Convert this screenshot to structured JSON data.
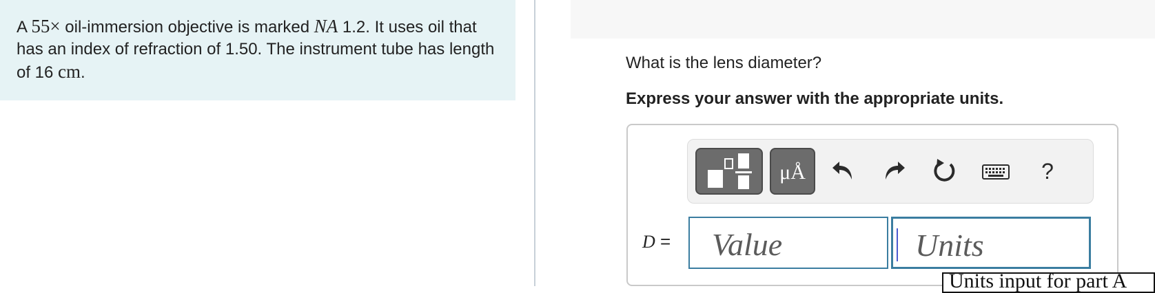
{
  "problem": {
    "seg1": "A ",
    "seg2": "55×",
    "seg3": " oil-immersion objective is marked ",
    "seg4": "NA",
    "seg5": " 1.2. It uses oil that has an index of refraction of 1.50. The instrument tube has length of 16 ",
    "seg6": "cm",
    "seg7": "."
  },
  "question": "What is the lens diameter?",
  "instruction": "Express your answer with the appropriate units.",
  "toolbar": {
    "units_label": "μÅ",
    "help_label": "?",
    "icons": [
      "templates-icon",
      "units-icon",
      "undo-icon",
      "redo-icon",
      "reset-icon",
      "keyboard-icon",
      "help-icon"
    ]
  },
  "answer": {
    "variable": "D",
    "equals": " =",
    "value_placeholder": "Value",
    "units_placeholder": "Units"
  },
  "tooltip": "Units input for part A",
  "colors": {
    "problem_bg": "#e6f3f5",
    "input_border": "#3a7da0",
    "toolbar_button": "#6c6c6c"
  }
}
